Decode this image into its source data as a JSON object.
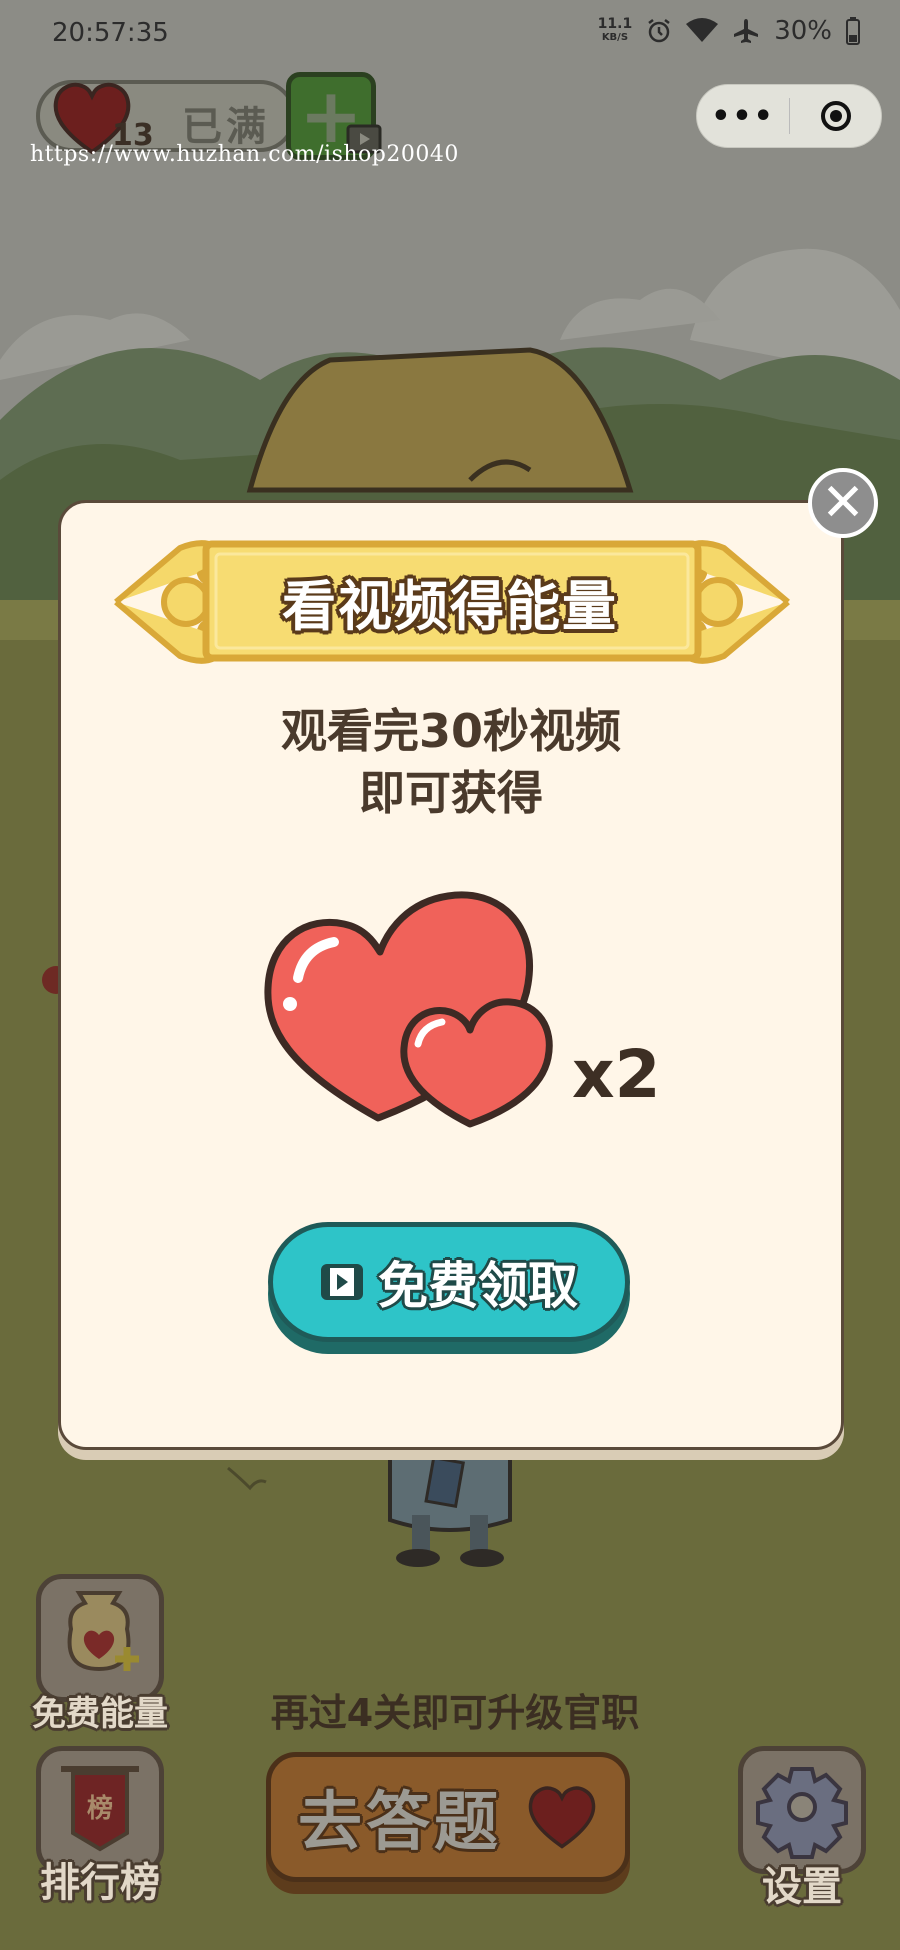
{
  "status_bar": {
    "time": "20:57:35",
    "speed_value": "11.1",
    "speed_unit": "KB/S",
    "battery": "30%"
  },
  "top": {
    "energy_count": "13",
    "energy_status": "已满",
    "watermark": "https://www.huzhan.com/ishop20040"
  },
  "capsule": {
    "more": "•••"
  },
  "modal": {
    "title": "看视频得能量",
    "desc_line1": "观看完30秒视频",
    "desc_line2": "即可获得",
    "multiplier": "x2",
    "claim_label": "免费领取",
    "close_symbol": "✕"
  },
  "bottom": {
    "free_energy_label": "免费能量",
    "ranking_label": "排行榜",
    "upgrade_text": "再过4关即可升级官职",
    "answer_label": "去答题",
    "settings_label": "设置",
    "ranking_banner": "榜"
  },
  "colors": {
    "heart": "#e85a52",
    "claim_button": "#2ec4c8",
    "banner": "#f5d86a",
    "modal_bg": "#fff6e8"
  }
}
